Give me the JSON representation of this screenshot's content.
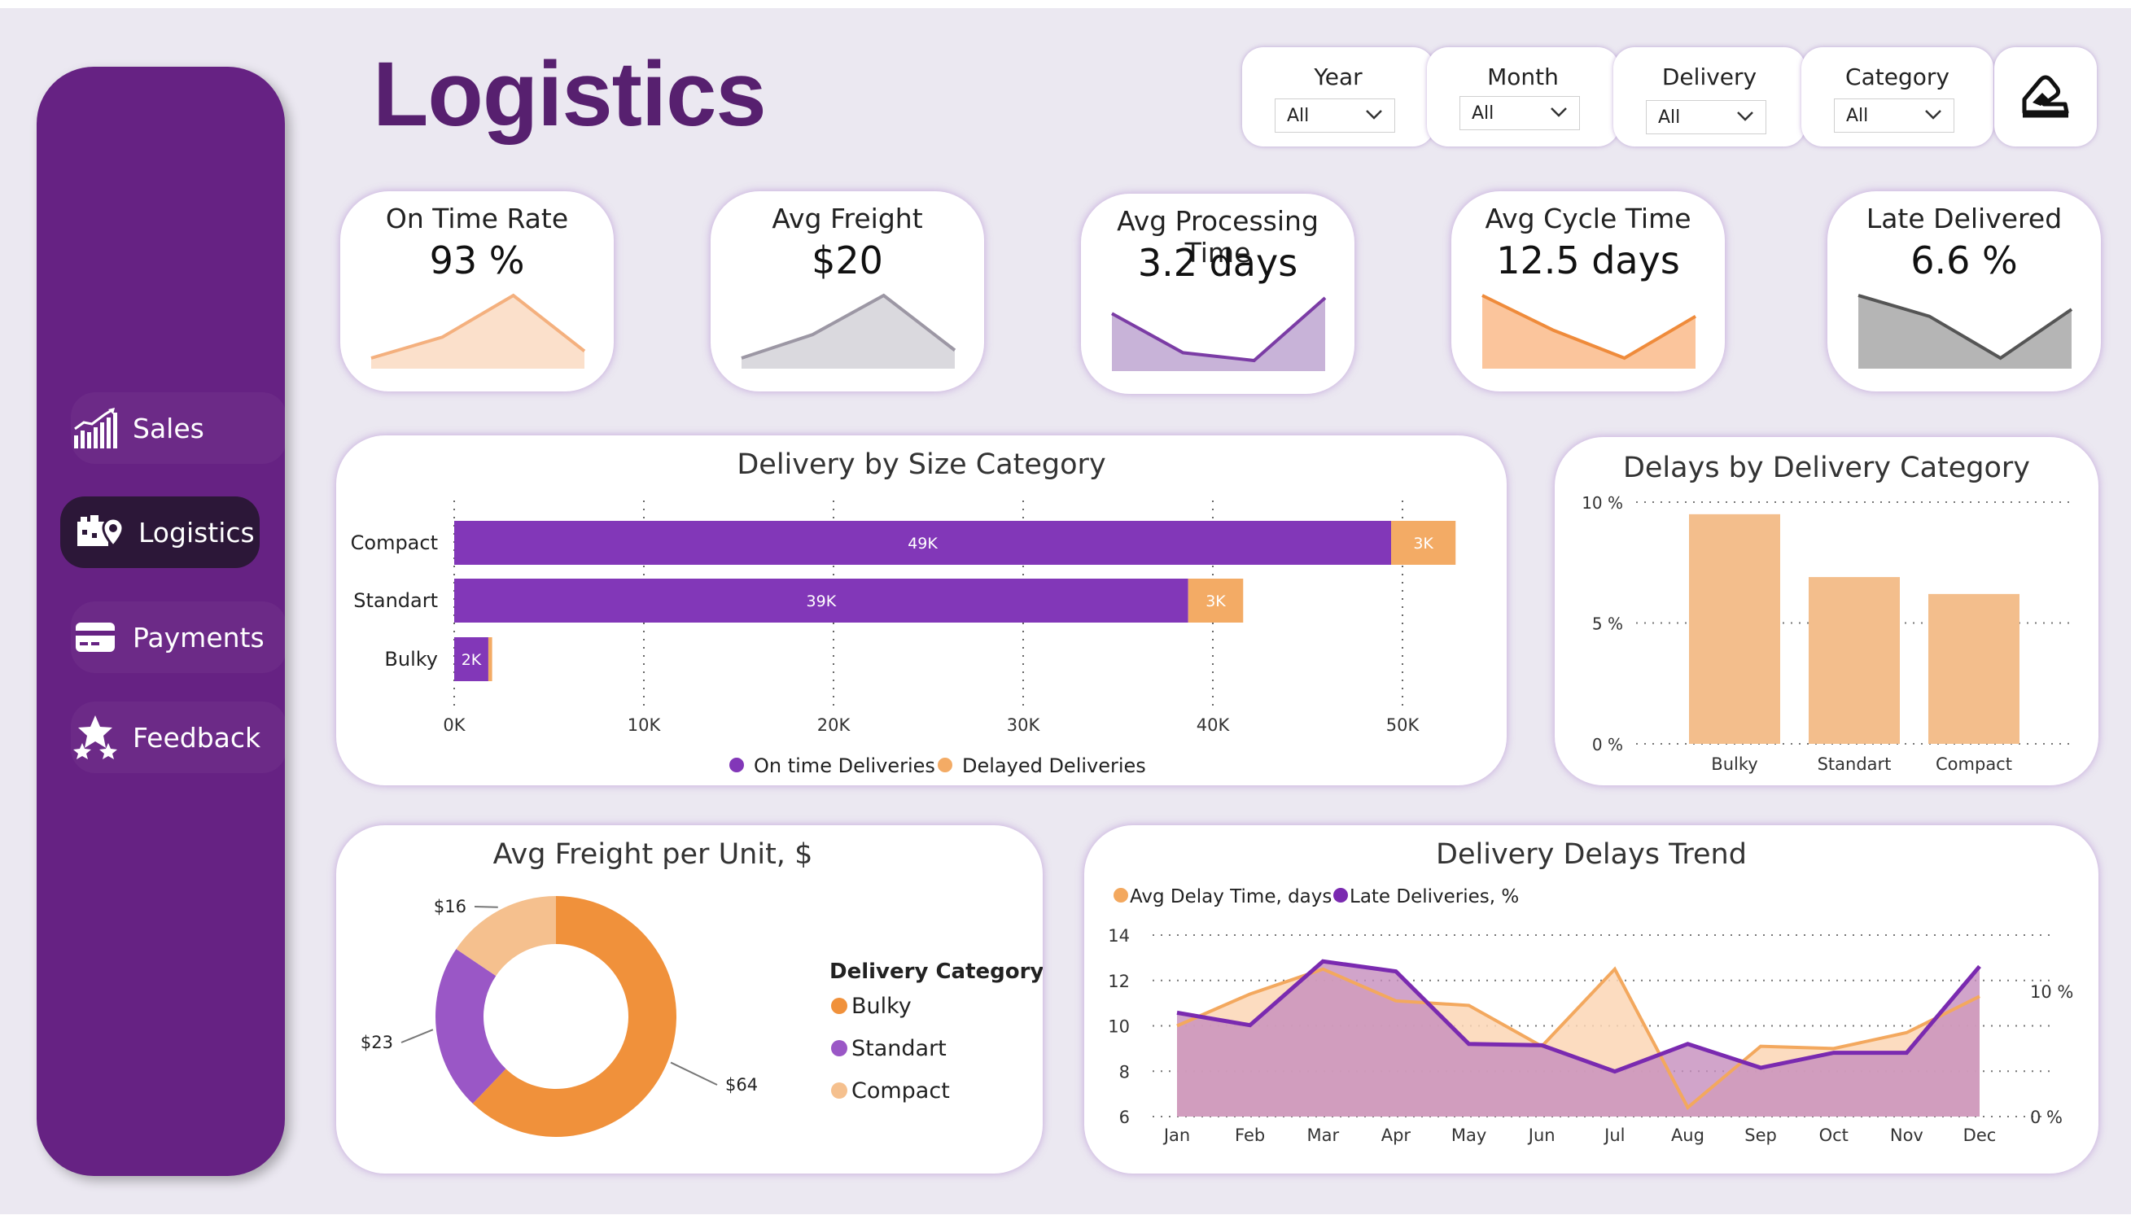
{
  "title": "Logistics",
  "nav": [
    {
      "label": "Sales",
      "icon": "sales-chart-icon"
    },
    {
      "label": "Logistics",
      "icon": "logistics-map-icon"
    },
    {
      "label": "Payments",
      "icon": "credit-card-icon"
    },
    {
      "label": "Feedback",
      "icon": "stars-icon"
    }
  ],
  "filters": [
    {
      "label": "Year",
      "value": "All"
    },
    {
      "label": "Month",
      "value": "All"
    },
    {
      "label": "Delivery",
      "value": "All"
    },
    {
      "label": "Category",
      "value": "All"
    }
  ],
  "reset_icon": "eraser-icon",
  "kpis": [
    {
      "label": "On Time Rate",
      "value": "93 %",
      "trend": [
        1,
        4,
        10,
        2
      ],
      "fill": "#fbe0cb",
      "stroke": "#f4b07e"
    },
    {
      "label": "Avg Freight",
      "value": "$20",
      "trend": [
        2,
        5,
        10,
        3
      ],
      "fill": "#dad9de",
      "stroke": "#9c97a4"
    },
    {
      "label": "Avg Processing Time",
      "value": "3.2 days",
      "trend": [
        8,
        3,
        2,
        10
      ],
      "fill": "#c8b3d8",
      "stroke": "#7b3ca5"
    },
    {
      "label": "Avg Cycle Time",
      "value": "12.5 days",
      "trend": [
        10,
        5,
        1,
        7
      ],
      "fill": "#fbc59c",
      "stroke": "#ef8b3b"
    },
    {
      "label": "Late Delivered",
      "value": "6.6 %",
      "trend": [
        10,
        7,
        1,
        8
      ],
      "fill": "#b5b5b5",
      "stroke": "#555555"
    }
  ],
  "colors": {
    "purple": "#8237b8",
    "orange": "#f3ab65",
    "peach": "#f3be8c",
    "sidebar": "#662283",
    "title": "#57206f",
    "donut_orange": "#f0913b",
    "donut_purple": "#9a57c6",
    "donut_peach": "#f5c08e",
    "trend_orange": "#f3a85e",
    "trend_orange_fill": "#fbd6b5",
    "trend_purple": "#7a2ab0",
    "trend_purple_fill": "#c58dbd"
  },
  "size_chart": {
    "title": "Delivery by Size Category",
    "legend": [
      "On time Deliveries",
      "Delayed Deliveries"
    ],
    "chart_data": {
      "type": "bar",
      "orientation": "horizontal",
      "stacked": true,
      "categories": [
        "Compact",
        "Standart",
        "Bulky"
      ],
      "series": [
        {
          "name": "On time Deliveries",
          "values": [
            49400,
            38700,
            1800
          ],
          "labels": [
            "49K",
            "39K",
            "2K"
          ]
        },
        {
          "name": "Delayed Deliveries",
          "values": [
            3400,
            2900,
            200
          ],
          "labels": [
            "3K",
            "3K",
            ""
          ]
        }
      ],
      "x_ticks": [
        "0K",
        "10K",
        "20K",
        "30K",
        "40K",
        "50K"
      ],
      "xlim": [
        0,
        53000
      ],
      "legend_position": "bottom"
    }
  },
  "delay_category_chart": {
    "title": "Delays by Delivery Category",
    "chart_data": {
      "type": "bar",
      "categories": [
        "Bulky",
        "Standart",
        "Compact"
      ],
      "values": [
        9.5,
        6.9,
        6.2
      ],
      "y_ticks": [
        "0 %",
        "5 %",
        "10 %"
      ],
      "ylim": [
        0,
        10
      ]
    }
  },
  "freight_chart": {
    "title": "Avg Freight per Unit, $",
    "legend_title": "Delivery Category",
    "chart_data": {
      "type": "pie",
      "donut": true,
      "labels": [
        "Bulky",
        "Standart",
        "Compact"
      ],
      "values": [
        64,
        23,
        16
      ],
      "value_labels": [
        "$64",
        "$23",
        "$16"
      ],
      "legend_position": "right"
    }
  },
  "trend_chart": {
    "title": "Delivery Delays Trend",
    "legend": [
      "Avg Delay Time, days",
      "Late Deliveries, %"
    ],
    "chart_data": {
      "type": "area",
      "categories": [
        "Jan",
        "Feb",
        "Mar",
        "Apr",
        "May",
        "Jun",
        "Jul",
        "Aug",
        "Sep",
        "Oct",
        "Nov",
        "Dec"
      ],
      "series": [
        {
          "name": "Avg Delay Time, days",
          "axis": "left",
          "values": [
            10,
            11.4,
            12.5,
            11.1,
            10.9,
            9.1,
            12.5,
            6.4,
            9.1,
            9.0,
            9.7,
            11.3
          ]
        },
        {
          "name": "Late Deliveries, %",
          "axis": "right",
          "values": [
            8.3,
            7.3,
            12.4,
            11.6,
            5.8,
            5.7,
            3.6,
            5.8,
            3.9,
            5.1,
            5.1,
            12.0
          ]
        }
      ],
      "y_left_ticks": [
        "6",
        "8",
        "10",
        "12",
        "14"
      ],
      "y_left_lim": [
        6,
        14
      ],
      "y_right_ticks": [
        "0 %",
        "10 %"
      ],
      "y_right_lim": [
        0,
        14.5
      ],
      "legend_position": "top-left"
    }
  }
}
